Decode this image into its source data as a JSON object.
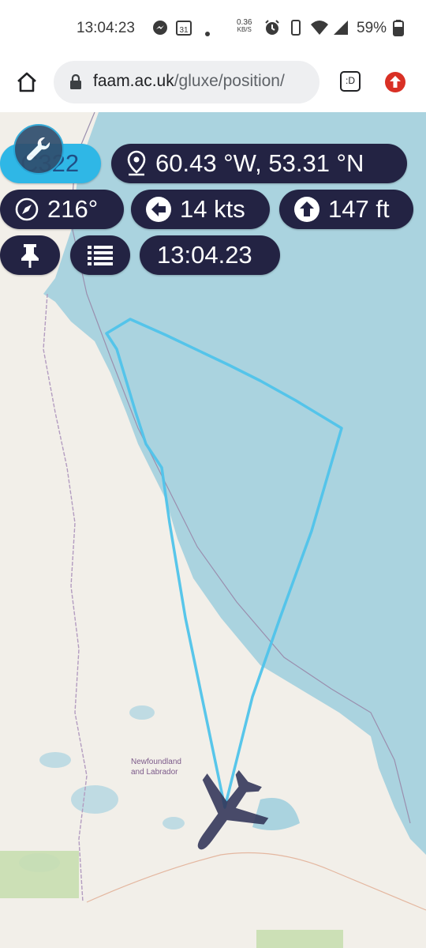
{
  "status_bar": {
    "time": "13:04:23",
    "net_speed": "0.36",
    "net_unit": "KB/S",
    "calendar_day": "31",
    "battery": "59%"
  },
  "browser": {
    "url_host": "faam.ac.uk",
    "url_path": "/gluxe/position/",
    "tab_label": ":D"
  },
  "panel": {
    "flight_id": "C322",
    "position": "60.43 °W, 53.31 °N",
    "heading": "216°",
    "speed": "14 kts",
    "altitude": "147 ft",
    "time": "13:04.23"
  },
  "map": {
    "region_label_line1": "Newfoundland",
    "region_label_line2": "and Labrador",
    "track_color": "#4fc3ea",
    "water_color": "#aad3df",
    "land_color": "#f2efe9"
  }
}
